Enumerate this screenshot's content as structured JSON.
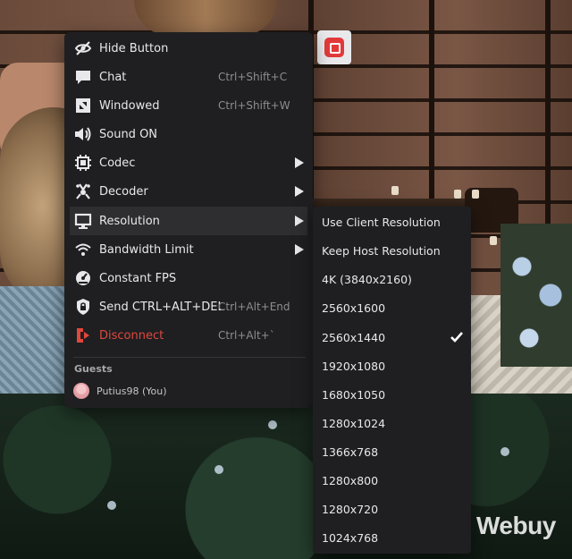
{
  "app_button": {
    "icon": "parsec-logo-icon",
    "color": "#e23a3a"
  },
  "menu": {
    "items": [
      {
        "label": "Hide Button",
        "icon": "eye-slash-icon"
      },
      {
        "label": "Chat",
        "shortcut": "Ctrl+Shift+C",
        "icon": "chat-bubble-icon"
      },
      {
        "label": "Windowed",
        "shortcut": "Ctrl+Shift+W",
        "icon": "windowed-icon"
      },
      {
        "label": "Sound ON",
        "icon": "speaker-icon"
      },
      {
        "label": "Codec",
        "icon": "chip-icon",
        "submenu": true
      },
      {
        "label": "Decoder",
        "icon": "decoder-icon",
        "submenu": true
      },
      {
        "label": "Resolution",
        "icon": "monitor-icon",
        "submenu": true,
        "active": true
      },
      {
        "label": "Bandwidth Limit",
        "icon": "wifi-icon",
        "submenu": true
      },
      {
        "label": "Constant FPS",
        "icon": "gauge-icon"
      },
      {
        "label": "Send CTRL+ALT+DEL",
        "shortcut": "Ctrl+Alt+End",
        "icon": "shield-lock-icon"
      },
      {
        "label": "Disconnect",
        "shortcut": "Ctrl+Alt+`",
        "icon": "disconnect-icon",
        "color": "#e2473d"
      }
    ],
    "guests_title": "Guests",
    "guest": {
      "name": "Putius98 (You)"
    }
  },
  "resolution_submenu": {
    "items": [
      {
        "label": "Use Client Resolution"
      },
      {
        "label": "Keep Host Resolution"
      },
      {
        "label": "4K (3840x2160)"
      },
      {
        "label": "2560x1600"
      },
      {
        "label": "2560x1440",
        "checked": true
      },
      {
        "label": "1920x1080"
      },
      {
        "label": "1680x1050"
      },
      {
        "label": "1280x1024"
      },
      {
        "label": "1366x768"
      },
      {
        "label": "1280x800"
      },
      {
        "label": "1280x720"
      },
      {
        "label": "1024x768"
      }
    ]
  },
  "watermark": "Webuy"
}
